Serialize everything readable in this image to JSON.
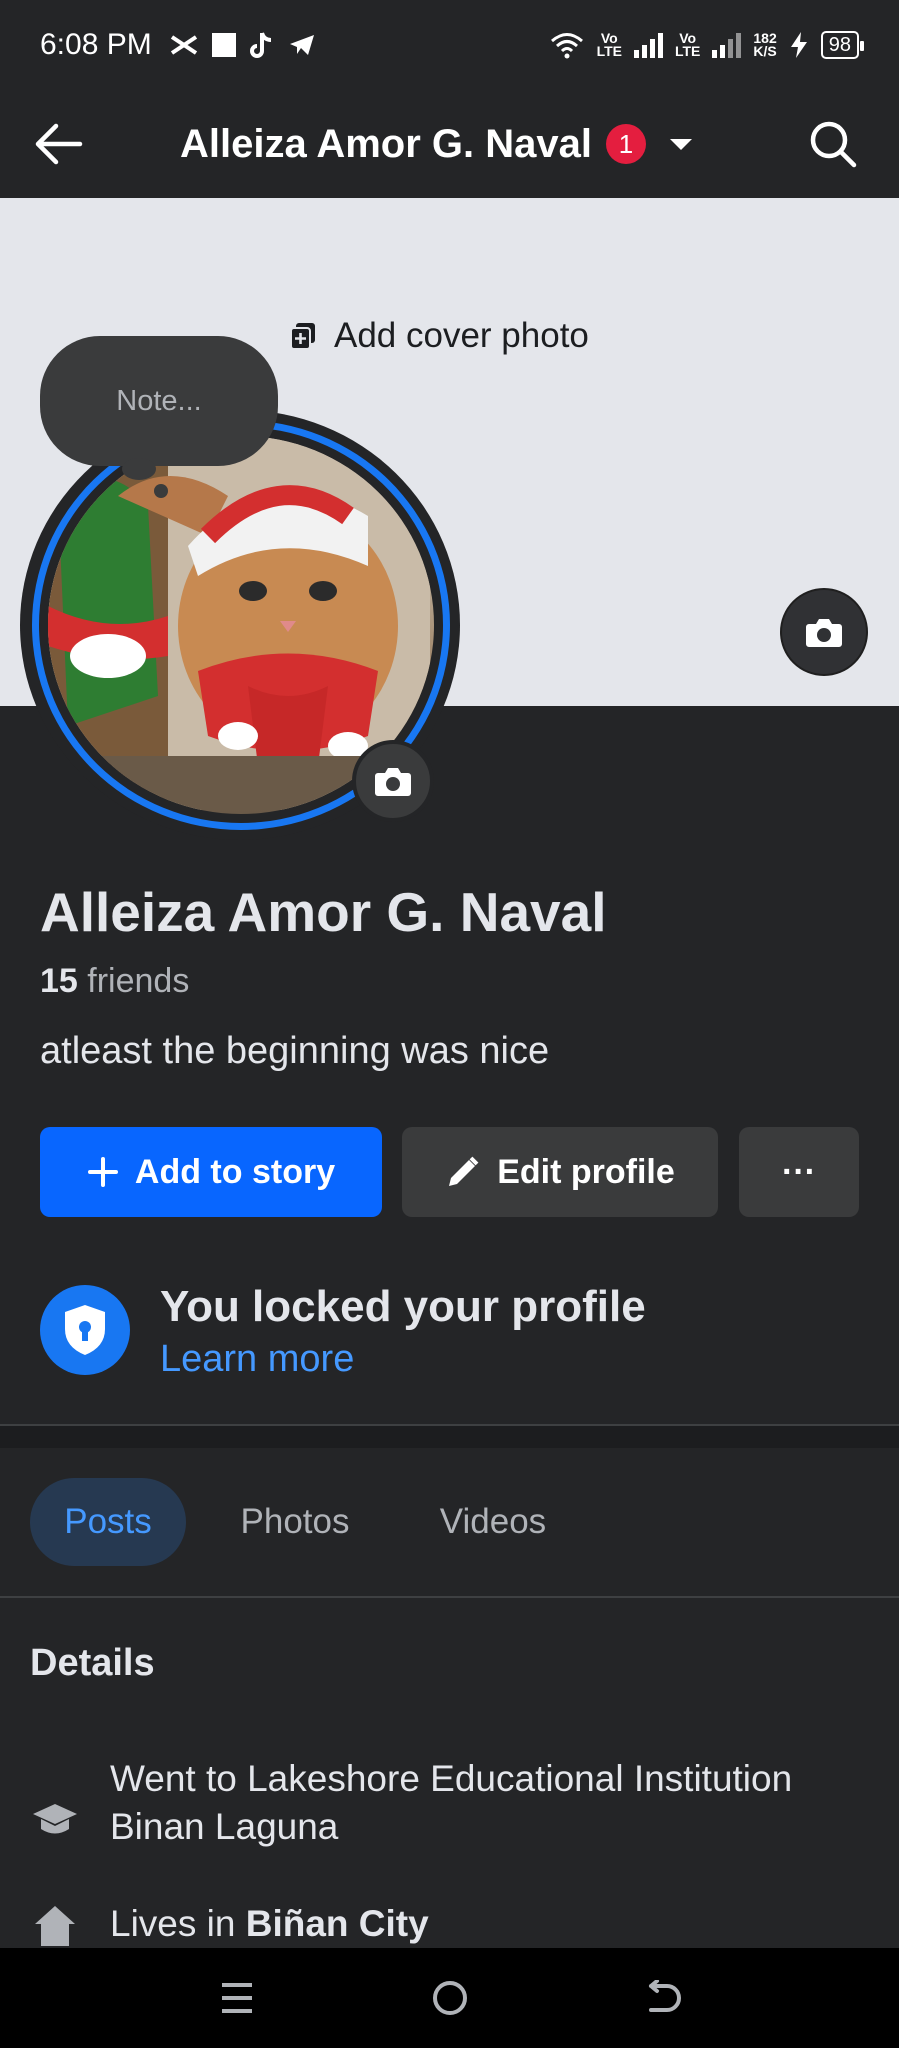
{
  "status_bar": {
    "time": "6:08 PM",
    "lte1": "Vo\nLTE",
    "lte2": "Vo\nLTE",
    "speed": "182\nK/S",
    "battery": "98"
  },
  "header": {
    "title": "Alleiza Amor G. Naval",
    "notification_count": "1"
  },
  "cover": {
    "add_cover_label": "Add cover photo"
  },
  "note": {
    "placeholder": "Note..."
  },
  "profile": {
    "name": "Alleiza Amor G. Naval",
    "friends_count": "15",
    "friends_label": " friends",
    "bio": "atleast the beginning was nice"
  },
  "actions": {
    "add_to_story": "Add to story",
    "edit_profile": "Edit profile",
    "more": "···"
  },
  "locked": {
    "title": "You locked your profile",
    "link": "Learn more"
  },
  "tabs": [
    {
      "label": "Posts",
      "active": true
    },
    {
      "label": "Photos",
      "active": false
    },
    {
      "label": "Videos",
      "active": false
    }
  ],
  "details": {
    "title": "Details",
    "education": "Went to Lakeshore Educational Institution Binan Laguna",
    "lives_prefix": "Lives in ",
    "lives_city": "Biñan City"
  },
  "colors": {
    "background": "#242527",
    "accent": "#0866ff",
    "link": "#4599ff",
    "badge": "#e41e3f"
  }
}
